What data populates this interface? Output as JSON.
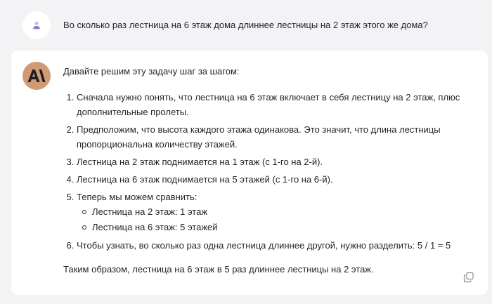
{
  "user_message": {
    "text": "Во сколько раз лестница на 6 этаж дома длиннее лестницы на 2 этаж этого же дома?",
    "avatar_icon": "user-icon"
  },
  "assistant_message": {
    "avatar_icon": "anthropic-logo-icon",
    "avatar_color": "#d09a74",
    "intro": "Давайте решим эту задачу шаг за шагом:",
    "steps": [
      "Сначала нужно понять, что лестница на 6 этаж включает в себя лестницу на 2 этаж, плюс дополнительные пролеты.",
      "Предположим, что высота каждого этажа одинакова. Это значит, что длина лестницы пропорциональна количеству этажей.",
      "Лестница на 2 этаж поднимается на 1 этаж (с 1-го на 2-й).",
      "Лестница на 6 этаж поднимается на 5 этажей (с 1-го на 6-й).",
      "Теперь мы можем сравнить:",
      "Чтобы узнать, во сколько раз одна лестница длиннее другой, нужно разделить: 5 / 1 = 5"
    ],
    "substeps": [
      "Лестница на 2 этаж: 1 этаж",
      "Лестница на 6 этаж: 5 этажей"
    ],
    "conclusion": "Таким образом, лестница на 6 этаж в 5 раз длиннее лестницы на 2 этаж.",
    "copy_icon": "copy-icon"
  }
}
